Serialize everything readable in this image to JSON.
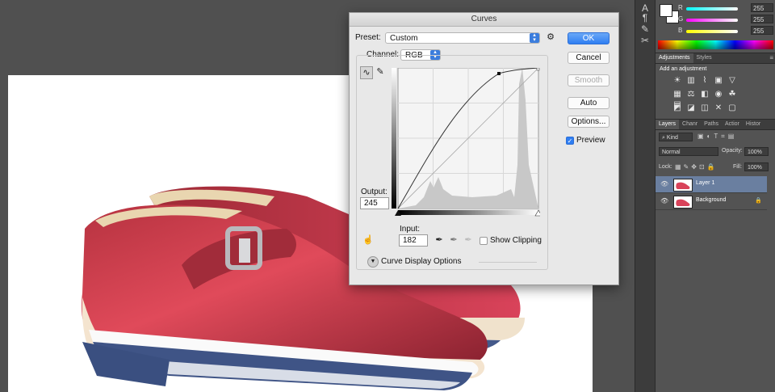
{
  "tools_strip": {
    "icons": [
      "character-icon",
      "paragraph-icon",
      "brush-icon",
      "settings-tools-icon"
    ]
  },
  "color_panel": {
    "r": {
      "label": "R",
      "value": "255"
    },
    "g": {
      "label": "G",
      "value": "255"
    },
    "b": {
      "label": "B",
      "value": "255"
    }
  },
  "adjustments_panel": {
    "tabs": [
      "Adjustments",
      "Styles"
    ],
    "title": "Add an adjustment"
  },
  "layers_panel": {
    "tabs": [
      "Layers",
      "Chanr",
      "Paths",
      "Actior",
      "Histor"
    ],
    "filter_kind": "Kind",
    "blend_mode": "Normal",
    "opacity_label": "Opacity:",
    "opacity_value": "100%",
    "lock_label": "Lock:",
    "fill_label": "Fill:",
    "fill_value": "100%",
    "layers": [
      {
        "name": "Layer 1",
        "selected": true
      },
      {
        "name": "Background",
        "selected": false
      }
    ]
  },
  "curves_dialog": {
    "title": "Curves",
    "preset_label": "Preset:",
    "preset_value": "Custom",
    "channel_label": "Channel:",
    "channel_value": "RGB",
    "output_label": "Output:",
    "output_value": "245",
    "input_label": "Input:",
    "input_value": "182",
    "show_clipping_label": "Show Clipping",
    "show_clipping_checked": false,
    "curve_display_label": "Curve Display Options",
    "buttons": {
      "ok": "OK",
      "cancel": "Cancel",
      "smooth": "Smooth",
      "auto": "Auto",
      "options": "Options..."
    },
    "preview_label": "Preview",
    "preview_checked": true
  },
  "colors": {
    "accent": "#2f7ef2",
    "panel_bg": "#535353",
    "dialog_bg": "#e8e8e8",
    "selected_layer": "#6a7fa0"
  }
}
